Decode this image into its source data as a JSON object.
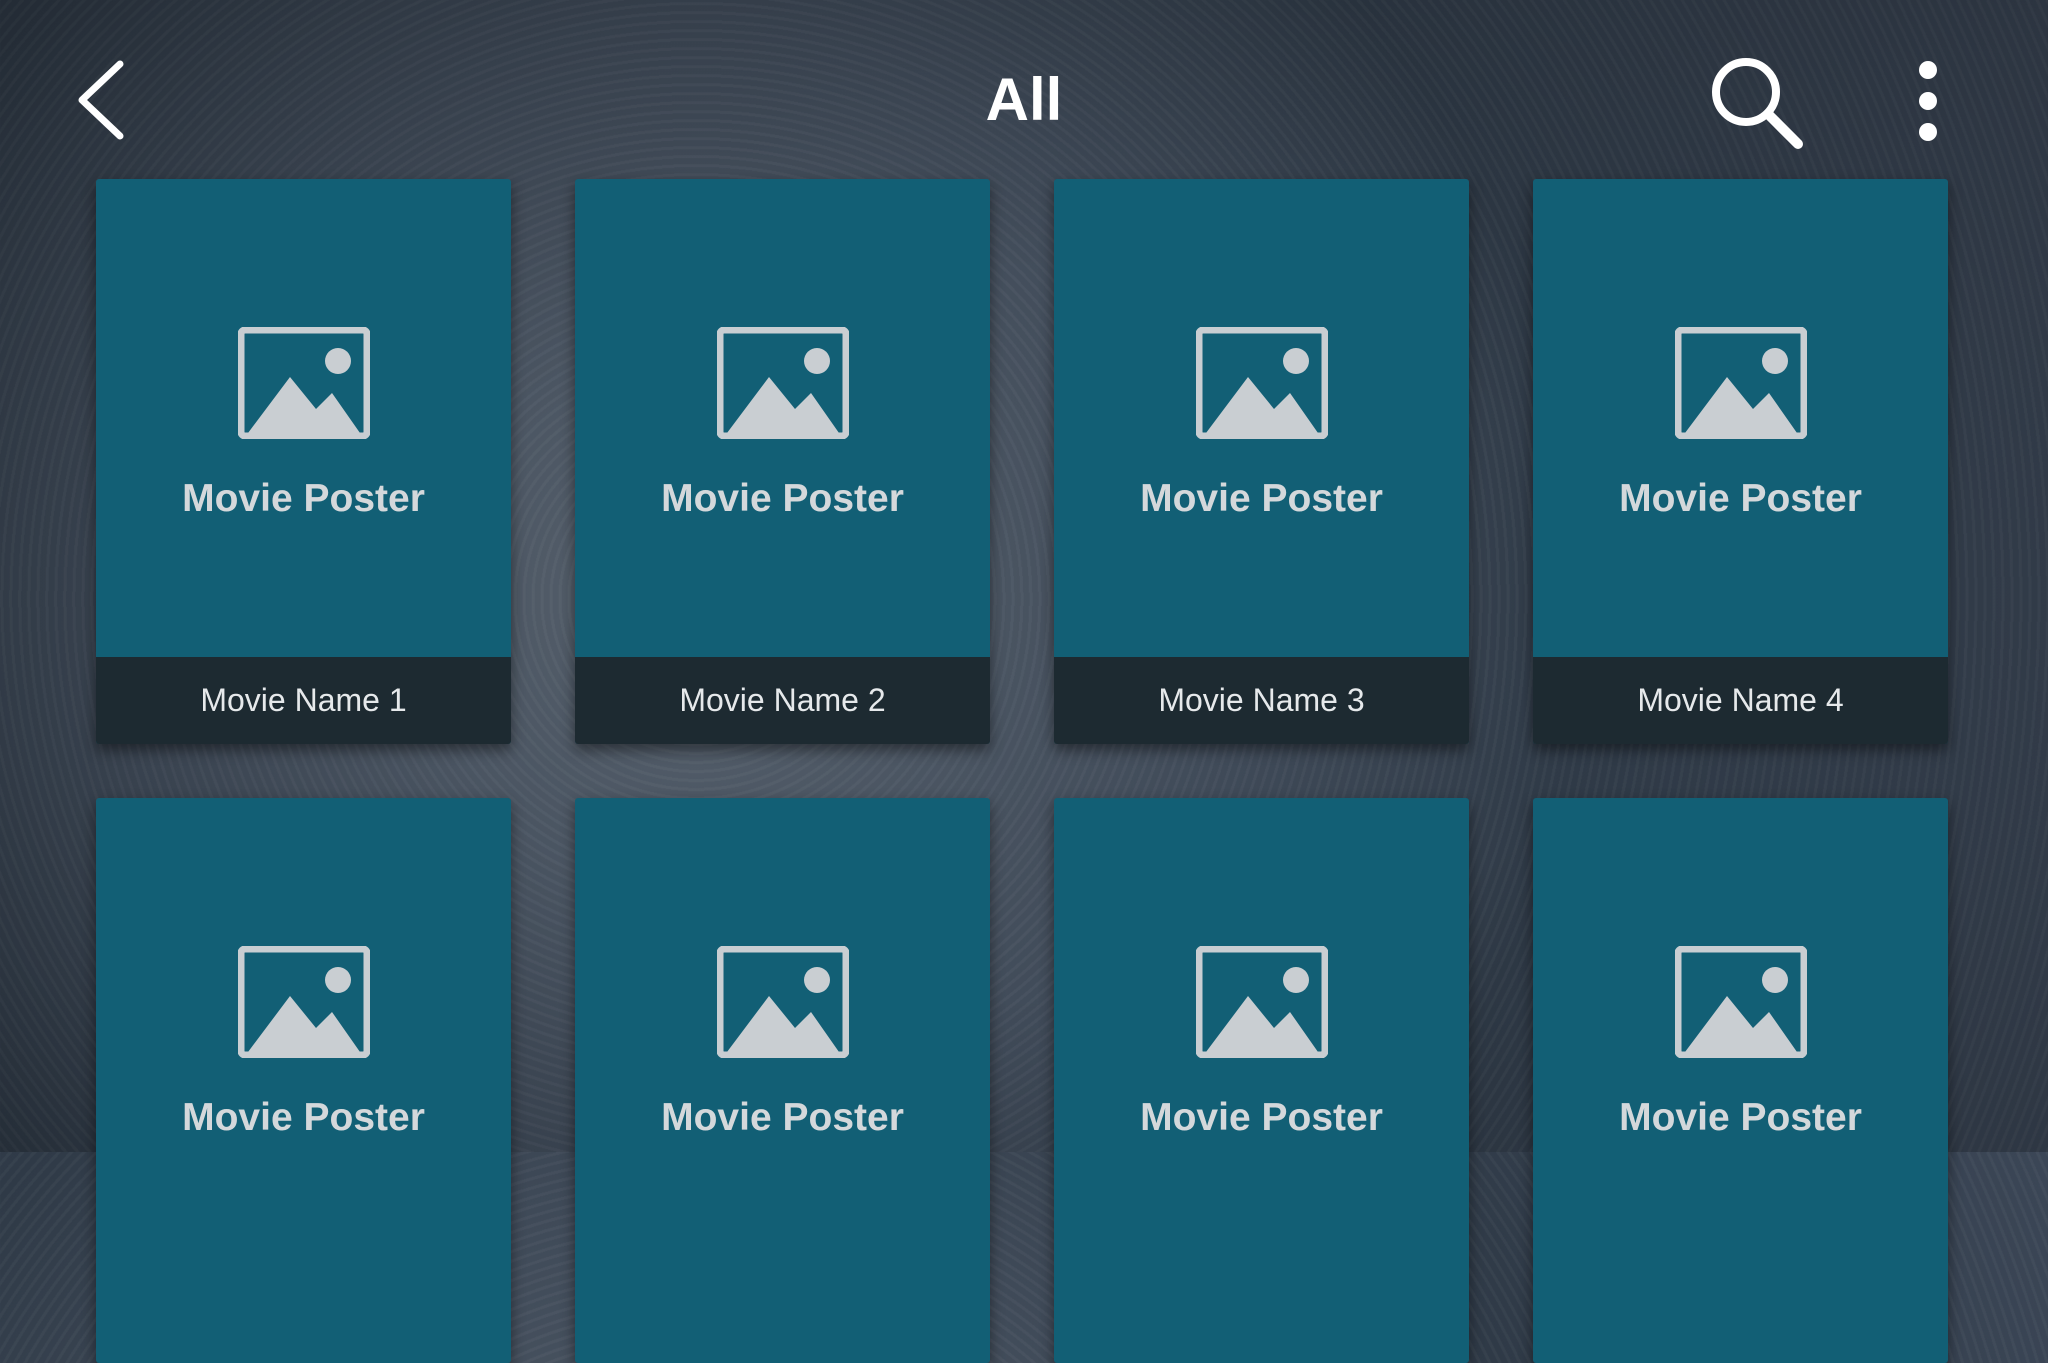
{
  "header": {
    "title": "All",
    "back_icon": "chevron-left-icon",
    "search_icon": "search-icon",
    "menu_icon": "more-vertical-icon"
  },
  "colors": {
    "card_background": "#125f75",
    "caption_background": "#1d2a31",
    "icon_color": "#c9ced2"
  },
  "movies": [
    {
      "poster_label": "Movie Poster",
      "name": "Movie Name 1"
    },
    {
      "poster_label": "Movie Poster",
      "name": "Movie Name 2"
    },
    {
      "poster_label": "Movie Poster",
      "name": "Movie Name 3"
    },
    {
      "poster_label": "Movie Poster",
      "name": "Movie Name 4"
    },
    {
      "poster_label": "Movie Poster"
    },
    {
      "poster_label": "Movie Poster"
    },
    {
      "poster_label": "Movie Poster"
    },
    {
      "poster_label": "Movie Poster"
    }
  ]
}
